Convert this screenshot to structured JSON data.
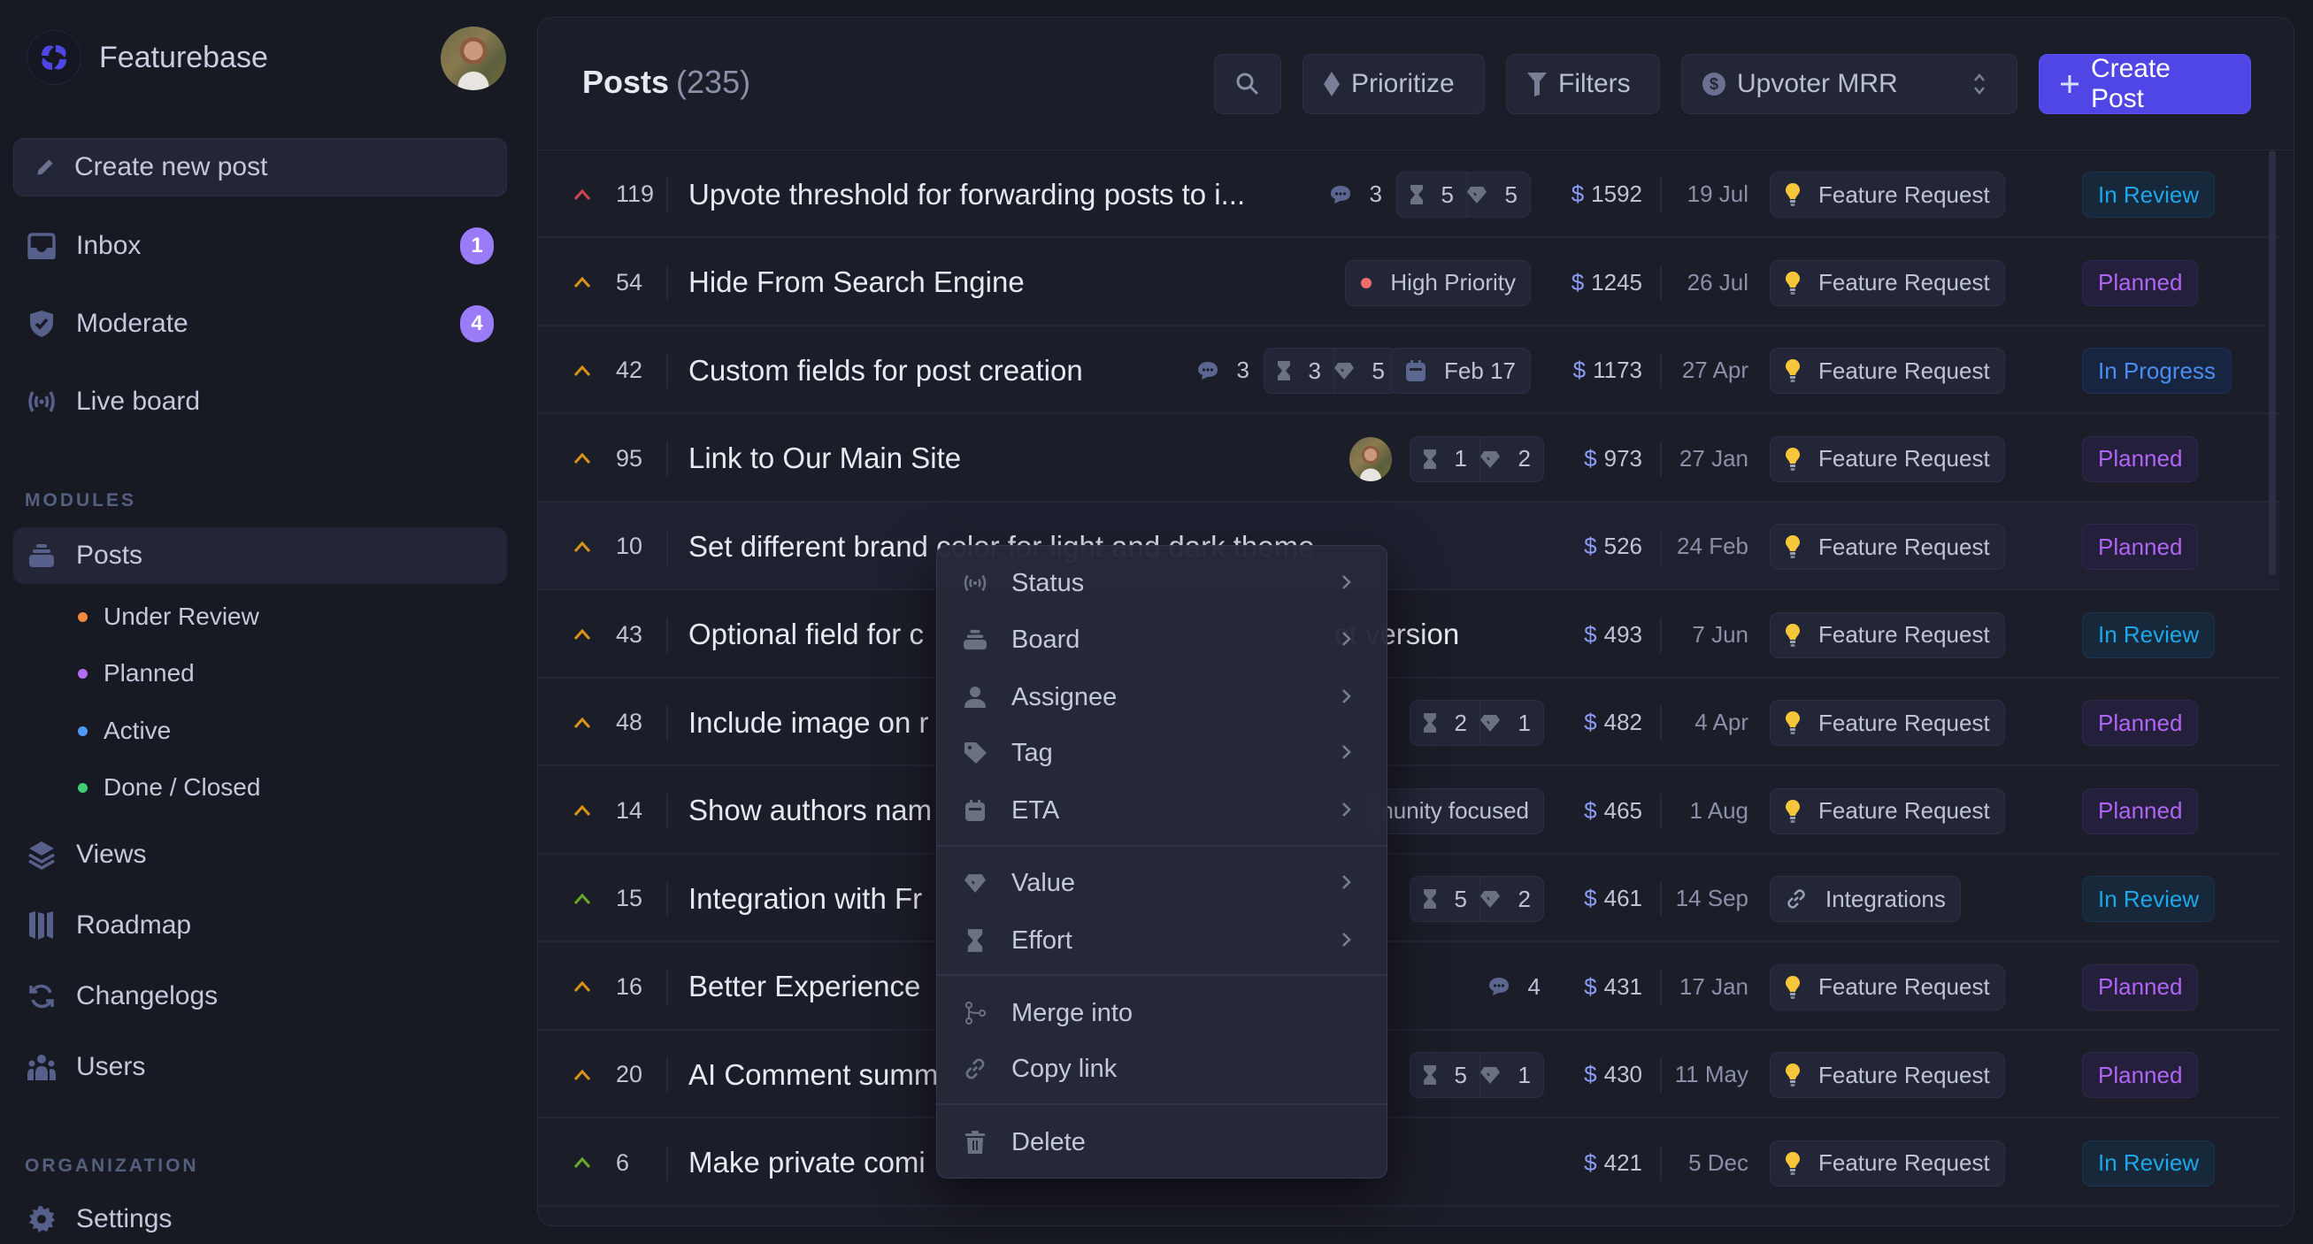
{
  "app": {
    "name": "Featurebase"
  },
  "sidebar": {
    "create_label": "Create new post",
    "top_items": [
      {
        "label": "Inbox",
        "icon": "inbox-icon",
        "badge": "1"
      },
      {
        "label": "Moderate",
        "icon": "shield-check-icon",
        "badge": "4"
      },
      {
        "label": "Live board",
        "icon": "broadcast-icon"
      }
    ],
    "modules_label": "MODULES",
    "posts_label": "Posts",
    "post_statuses": [
      {
        "label": "Under Review",
        "color": "#f48a3a"
      },
      {
        "label": "Planned",
        "color": "#b36cf4"
      },
      {
        "label": "Active",
        "color": "#4e9af6"
      },
      {
        "label": "Done / Closed",
        "color": "#3ecf74"
      }
    ],
    "module_items": [
      {
        "label": "Views",
        "icon": "layers-icon"
      },
      {
        "label": "Roadmap",
        "icon": "roadmap-icon"
      },
      {
        "label": "Changelogs",
        "icon": "refresh-icon"
      },
      {
        "label": "Users",
        "icon": "users-icon"
      }
    ],
    "org_label": "ORGANIZATION",
    "org_items": [
      {
        "label": "Settings",
        "icon": "gear-icon"
      }
    ]
  },
  "header": {
    "title": "Posts",
    "count": "(235)",
    "prioritize_label": "Prioritize",
    "filters_label": "Filters",
    "sort_select_value": "Upvoter MRR",
    "create_label": "Create Post"
  },
  "posts": [
    {
      "upvotes": "119",
      "arrow_color": "#d0454e",
      "title": "Upvote threshold for forwarding posts to i...",
      "comments": "3",
      "effort": "5",
      "value": "5",
      "mrr": "1592",
      "date": "19 Jul",
      "tag": "Feature Request",
      "tag_icon": "lightbulb-icon",
      "status": "In Review"
    },
    {
      "upvotes": "54",
      "arrow_color": "#d99418",
      "title": "Hide From Search Engine",
      "priority": "High Priority",
      "mrr": "1245",
      "date": "26 Jul",
      "tag": "Feature Request",
      "tag_icon": "lightbulb-icon",
      "status": "Planned"
    },
    {
      "upvotes": "42",
      "arrow_color": "#d99418",
      "title": "Custom fields for post creation",
      "comments": "3",
      "effort": "3",
      "value": "5",
      "eta": "Feb 17",
      "mrr": "1173",
      "date": "27 Apr",
      "tag": "Feature Request",
      "tag_icon": "lightbulb-icon",
      "status": "In Progress"
    },
    {
      "upvotes": "95",
      "arrow_color": "#d99418",
      "title": "Link to Our Main Site",
      "assignee_avatar": true,
      "effort": "1",
      "value": "2",
      "mrr": "973",
      "date": "27 Jan",
      "tag": "Feature Request",
      "tag_icon": "lightbulb-icon",
      "status": "Planned"
    },
    {
      "upvotes": "10",
      "arrow_color": "#d99418",
      "title": "Set different brand color for light and dark theme",
      "mrr": "526",
      "date": "24 Feb",
      "tag": "Feature Request",
      "tag_icon": "lightbulb-icon",
      "status": "Planned"
    },
    {
      "upvotes": "43",
      "arrow_color": "#d99418",
      "title": "Optional field for c",
      "title_tail": "ct version",
      "mrr": "493",
      "date": "7 Jun",
      "tag": "Feature Request",
      "tag_icon": "lightbulb-icon",
      "status": "In Review"
    },
    {
      "upvotes": "48",
      "arrow_color": "#d99418",
      "title": "Include image on r",
      "effort": "2",
      "value": "1",
      "mrr": "482",
      "date": "4 Apr",
      "tag": "Feature Request",
      "tag_icon": "lightbulb-icon",
      "status": "Planned"
    },
    {
      "upvotes": "14",
      "arrow_color": "#d99418",
      "title": "Show authors nam",
      "extra_tag": "nunity focused",
      "mrr": "465",
      "date": "1 Aug",
      "tag": "Feature Request",
      "tag_icon": "lightbulb-icon",
      "status": "Planned"
    },
    {
      "upvotes": "15",
      "arrow_color": "#6aaa2a",
      "title": "Integration with Fr",
      "effort": "5",
      "value": "2",
      "mrr": "461",
      "date": "14 Sep",
      "tag": "Integrations",
      "tag_icon": "link-icon",
      "status": "In Review"
    },
    {
      "upvotes": "16",
      "arrow_color": "#d99418",
      "title": "Better Experience",
      "comments": "4",
      "mrr": "431",
      "date": "17 Jan",
      "tag": "Feature Request",
      "tag_icon": "lightbulb-icon",
      "status": "Planned"
    },
    {
      "upvotes": "20",
      "arrow_color": "#d99418",
      "title": "AI Comment summ",
      "effort": "5",
      "value": "1",
      "mrr": "430",
      "date": "11 May",
      "tag": "Feature Request",
      "tag_icon": "lightbulb-icon",
      "status": "Planned"
    },
    {
      "upvotes": "6",
      "arrow_color": "#6aaa2a",
      "title": "Make private comi",
      "mrr": "421",
      "date": "5 Dec",
      "tag": "Feature Request",
      "tag_icon": "lightbulb-icon",
      "status": "In Review"
    }
  ],
  "context_menu": {
    "items": [
      {
        "label": "Status",
        "icon": "broadcast-icon",
        "submenu": true
      },
      {
        "label": "Board",
        "icon": "board-icon",
        "submenu": true
      },
      {
        "label": "Assignee",
        "icon": "user-icon",
        "submenu": true
      },
      {
        "label": "Tag",
        "icon": "tag-icon",
        "submenu": true
      },
      {
        "label": "ETA",
        "icon": "calendar-icon",
        "submenu": true
      },
      {
        "label": "Value",
        "icon": "diamond-icon",
        "submenu": true
      },
      {
        "label": "Effort",
        "icon": "hourglass-icon",
        "submenu": true
      },
      {
        "label": "Merge into",
        "icon": "merge-icon",
        "submenu": false
      },
      {
        "label": "Copy link",
        "icon": "link-icon",
        "submenu": false
      },
      {
        "label": "Delete",
        "icon": "trash-icon",
        "submenu": false
      }
    ]
  },
  "colors": {
    "accent": "#4f46e5",
    "badge": "#9a7cf9",
    "status_in_review": "#1ea7e8",
    "status_planned": "#b065f5",
    "status_in_progress": "#4b8ef0",
    "high_priority_dot": "#f26b6b",
    "dollar": "#8d9cf7"
  }
}
